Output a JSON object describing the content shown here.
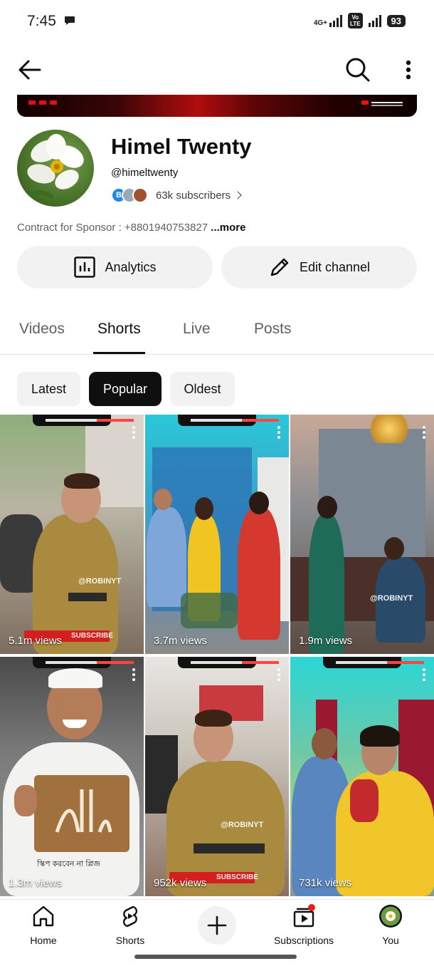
{
  "status_bar": {
    "time": "7:45",
    "network": "4G+",
    "volte": "Vo\nLTE",
    "battery": "93"
  },
  "app_bar": {
    "back_icon": "arrow-left-icon",
    "search_icon": "search-icon",
    "more_icon": "more-vert-icon"
  },
  "channel": {
    "name": "Himel Twenty",
    "handle": "@himeltwenty",
    "subscribers": "63k subscribers",
    "subscriber_avatar_letter": "B",
    "description": "Contract for Sponsor : +8801940753827",
    "more_label": "...more"
  },
  "actions": {
    "analytics_label": "Analytics",
    "edit_label": "Edit channel"
  },
  "tabs": [
    {
      "label": "Videos",
      "active": false
    },
    {
      "label": "Shorts",
      "active": true
    },
    {
      "label": "Live",
      "active": false
    },
    {
      "label": "Posts",
      "active": false
    }
  ],
  "chips": [
    {
      "label": "Latest",
      "active": false
    },
    {
      "label": "Popular",
      "active": true
    },
    {
      "label": "Oldest",
      "active": false
    }
  ],
  "shorts": [
    {
      "views": "5.1m views"
    },
    {
      "views": "3.7m views"
    },
    {
      "views": "1.9m views"
    },
    {
      "views": "1.3m views"
    },
    {
      "views": "952k views"
    },
    {
      "views": "731k views"
    }
  ],
  "watermarks": {
    "robin": "@ROBINYT",
    "subscribe": "SUBSCRIBE",
    "skip_text": "স্কিপ করবেন না প্লিজ"
  },
  "bottom_nav": [
    {
      "label": "Home",
      "icon": "home-icon"
    },
    {
      "label": "Shorts",
      "icon": "shorts-icon"
    },
    {
      "label": "",
      "icon": "create-plus-icon"
    },
    {
      "label": "Subscriptions",
      "icon": "subscriptions-icon"
    },
    {
      "label": "You",
      "icon": "you-avatar-icon"
    }
  ],
  "colors": {
    "accent_dark": "#0f0f0f",
    "chip_bg": "#f2f2f2",
    "notification_dot": "#e62117"
  }
}
